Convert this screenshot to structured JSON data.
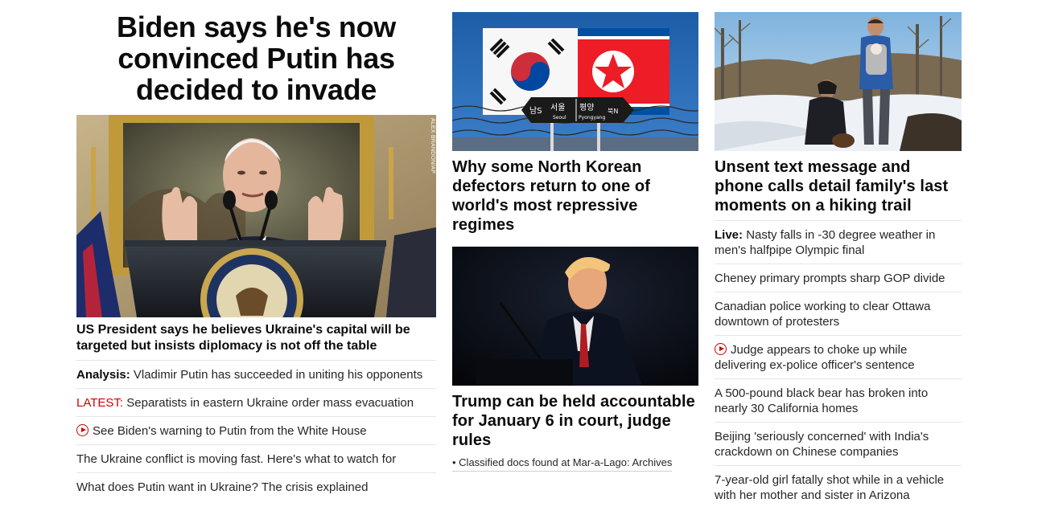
{
  "lead": {
    "headline": "Biden says he's now convinced Putin has decided to invade",
    "photo_credit": "ALEX BRANDON/AP",
    "caption": "US President says he believes Ukraine's capital will be targeted but insists diplomacy is not off the table",
    "links": [
      {
        "label": "Analysis:",
        "text": "Vladimir Putin has succeeded in uniting his opponents"
      },
      {
        "label": "LATEST:",
        "text": "Separatists in eastern Ukraine order mass evacuation"
      },
      {
        "icon": "play-icon",
        "text": "See Biden's warning to Putin from the White House"
      },
      {
        "text": "The Ukraine conflict is moving fast. Here's what to watch for"
      },
      {
        "text": "What does Putin want in Ukraine? The crisis explained"
      }
    ]
  },
  "middle": {
    "story1": {
      "sign": {
        "left_kr": "남S",
        "seoul_kr": "서울",
        "seoul_en": "Seoul",
        "pyongyang_kr": "평양",
        "pyongyang_en": "Pyongyang",
        "right_kr": "북N"
      },
      "headline": "Why some North Korean defectors return to one of world's most repressive regimes"
    },
    "story2": {
      "headline": "Trump can be held accountable for January 6 in court, judge rules",
      "related": "• Classified docs found at Mar-a-Lago: Archives"
    }
  },
  "right": {
    "headline": "Unsent text message and phone calls detail family's last moments on a hiking trail",
    "links": [
      {
        "label": "Live:",
        "text": "Nasty falls in -30 degree weather in men's halfpipe Olympic final"
      },
      {
        "text": "Cheney primary prompts sharp GOP divide"
      },
      {
        "text": "Canadian police working to clear Ottawa downtown of protesters"
      },
      {
        "icon": "play-icon",
        "text": "Judge appears to choke up while delivering ex-police officer's sentence"
      },
      {
        "text": "A 500-pound black bear has broken into nearly 30 California homes"
      },
      {
        "text": "Beijing 'seriously concerned' with India's crackdown on Chinese companies"
      },
      {
        "text": "7-year-old girl fatally shot while in a vehicle with her mother and sister in Arizona"
      }
    ]
  },
  "colors": {
    "accent_red": "#cc0000",
    "text": "#0c0c0c",
    "divider": "#e6e6e6"
  }
}
